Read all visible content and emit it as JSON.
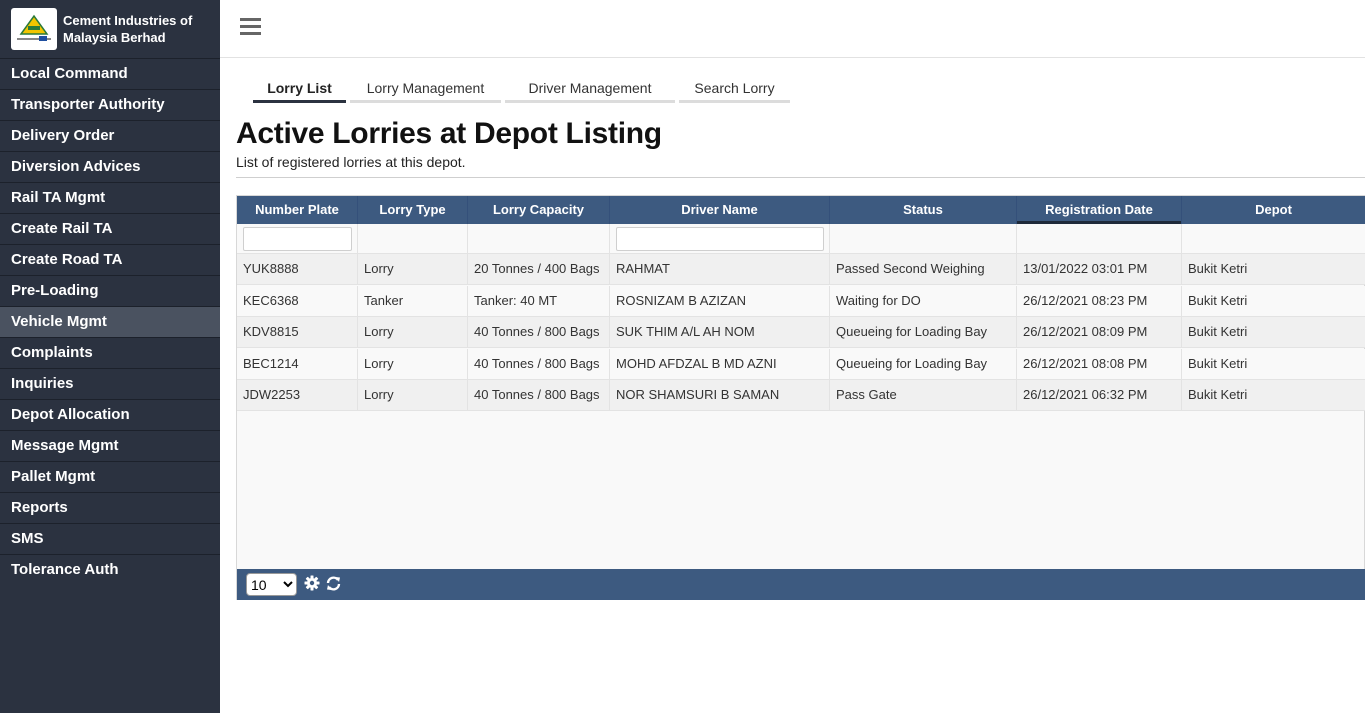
{
  "brand": {
    "name": "Cement Industries of Malaysia Berhad"
  },
  "sidebar": {
    "items": [
      {
        "label": "Local Command"
      },
      {
        "label": "Transporter Authority"
      },
      {
        "label": "Delivery Order"
      },
      {
        "label": "Diversion Advices"
      },
      {
        "label": "Rail TA Mgmt"
      },
      {
        "label": "Create Rail TA"
      },
      {
        "label": "Create Road TA"
      },
      {
        "label": "Pre-Loading"
      },
      {
        "label": "Vehicle Mgmt",
        "active": true
      },
      {
        "label": "Complaints"
      },
      {
        "label": "Inquiries"
      },
      {
        "label": "Depot Allocation"
      },
      {
        "label": "Message Mgmt"
      },
      {
        "label": "Pallet Mgmt"
      },
      {
        "label": "Reports"
      },
      {
        "label": "SMS"
      },
      {
        "label": "Tolerance Auth"
      }
    ]
  },
  "tabs": [
    {
      "label": "Lorry List",
      "active": true
    },
    {
      "label": "Lorry Management"
    },
    {
      "label": "Driver Management"
    },
    {
      "label": "Search Lorry"
    }
  ],
  "page": {
    "title": "Active Lorries at Depot Listing",
    "subtitle": "List of registered lorries at this depot."
  },
  "table": {
    "columns": [
      "Number Plate",
      "Lorry Type",
      "Lorry Capacity",
      "Driver Name",
      "Status",
      "Registration Date",
      "Depot"
    ],
    "sorted_column": "Registration Date",
    "filter_values": {
      "number_plate": "",
      "driver_name": ""
    },
    "rows": [
      [
        "YUK8888",
        "Lorry",
        "20 Tonnes / 400 Bags",
        "RAHMAT",
        "Passed Second Weighing",
        "13/01/2022 03:01 PM",
        "Bukit Ketri"
      ],
      [
        "KEC6368",
        "Tanker",
        "Tanker: 40 MT",
        "ROSNIZAM B AZIZAN",
        "Waiting for DO",
        "26/12/2021 08:23 PM",
        "Bukit Ketri"
      ],
      [
        "KDV8815",
        "Lorry",
        "40 Tonnes / 800 Bags",
        "SUK THIM A/L AH NOM",
        "Queueing for Loading Bay",
        "26/12/2021 08:09 PM",
        "Bukit Ketri"
      ],
      [
        "BEC1214",
        "Lorry",
        "40 Tonnes / 800 Bags",
        "MOHD AFDZAL B MD AZNI",
        "Queueing for Loading Bay",
        "26/12/2021 08:08 PM",
        "Bukit Ketri"
      ],
      [
        "JDW2253",
        "Lorry",
        "40 Tonnes / 800 Bags",
        "NOR SHAMSURI B SAMAN",
        "Pass Gate",
        "26/12/2021 06:32 PM",
        "Bukit Ketri"
      ]
    ]
  },
  "pager": {
    "page_size": "10",
    "page_size_options": [
      "10"
    ]
  },
  "icons": {
    "menu": "hamburger-icon",
    "settings": "gear-icon",
    "refresh": "refresh-icon"
  },
  "colors": {
    "sidebar_bg": "#2b3240",
    "sidebar_active": "#4a5260",
    "grid_header": "#3d5a80",
    "logo_accent": "#f2c500"
  }
}
